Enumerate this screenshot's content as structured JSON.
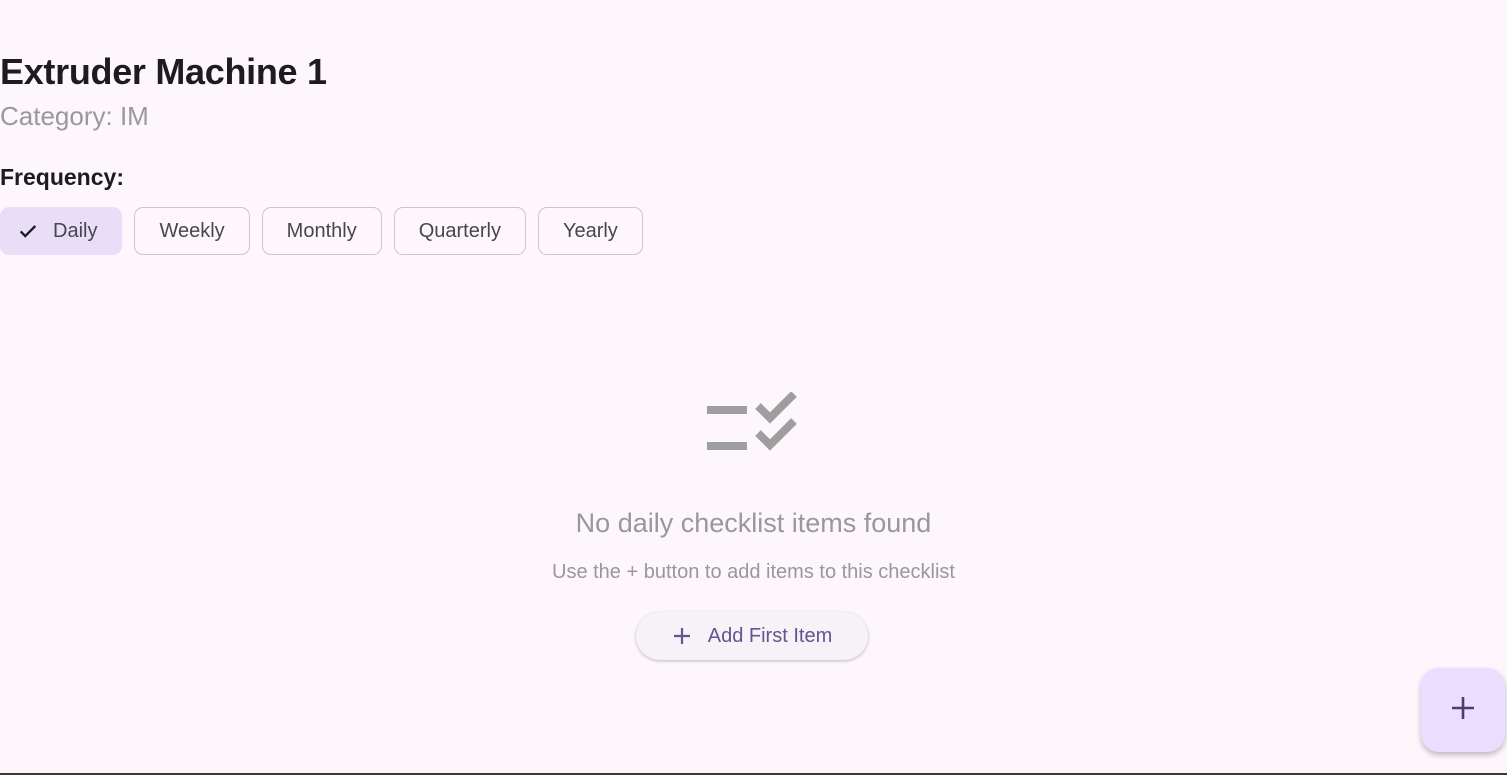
{
  "machine": {
    "title": "Extruder Machine 1",
    "category": "Category: IM"
  },
  "frequency": {
    "label": "Frequency:",
    "options": [
      {
        "label": "Daily",
        "selected": true
      },
      {
        "label": "Weekly",
        "selected": false
      },
      {
        "label": "Monthly",
        "selected": false
      },
      {
        "label": "Quarterly",
        "selected": false
      },
      {
        "label": "Yearly",
        "selected": false
      }
    ]
  },
  "empty_state": {
    "icon": "checklist-icon",
    "title": "No daily checklist items found",
    "subtitle": "Use the + button to add items to this checklist",
    "add_first_label": "Add First Item"
  },
  "fab": {
    "icon": "plus-icon"
  },
  "colors": {
    "background": "#fdf7fd",
    "selected_chip": "#e8def8",
    "accent": "#65558f",
    "fab": "#eaddff"
  }
}
